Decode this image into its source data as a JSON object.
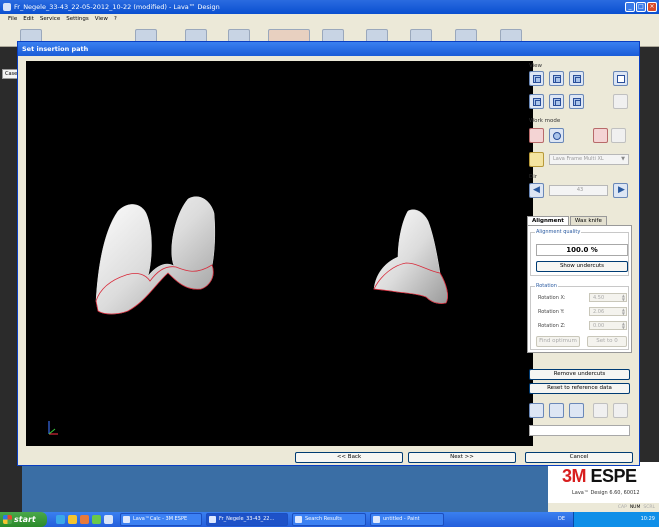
{
  "app": {
    "title": "Fr_Negele_33-43_22-05-2012_10-22 (modified) - Lava™ Design",
    "menu": [
      "File",
      "Edit",
      "Service",
      "Settings",
      "View",
      "?"
    ],
    "case_tab": "Case",
    "brand": "ESPE",
    "brand_prefix": "3M",
    "version": "Lava™ Design 6.60, 60012",
    "status": [
      "CAP",
      "NUM",
      "SCRL"
    ]
  },
  "dialog": {
    "title": "Set insertion path",
    "view_label": "View",
    "work_mode_label": "Work mode",
    "material_combo": "Lava Frame Multi XL",
    "dir_label": "Dir",
    "dir_value": "43",
    "tabs": [
      "Alignment",
      "Wax knife"
    ],
    "alignment_quality_label": "Alignment quality",
    "alignment_quality_value": "100.0 %",
    "show_undercuts": "Show undercuts",
    "rotation_label": "Rotation",
    "rotation_x_label": "Rotation X:",
    "rotation_y_label": "Rotation Y:",
    "rotation_z_label": "Rotation Z:",
    "rotation_x": "4.50",
    "rotation_y": "2.06",
    "rotation_z": "0.00",
    "find_optimum": "Find optimum",
    "set_to_0": "Set to 0",
    "remove_undercuts": "Remove undercuts",
    "reset_reference": "Reset to reference data",
    "back": "<< Back",
    "next": "Next >>",
    "cancel": "Cancel"
  },
  "taskbar": {
    "start": "start",
    "items": [
      "Lava™Calc - 3M ESPE",
      "Fr_Negele_33-43_22...",
      "Search Results",
      "untitled - Paint"
    ],
    "lang": "DE",
    "clock": "10:29"
  },
  "colors": {
    "title_blue": "#1a5cd8",
    "viewport": "#000000",
    "margin_line": "#d82a3a",
    "brand_red": "#d81e1e"
  }
}
